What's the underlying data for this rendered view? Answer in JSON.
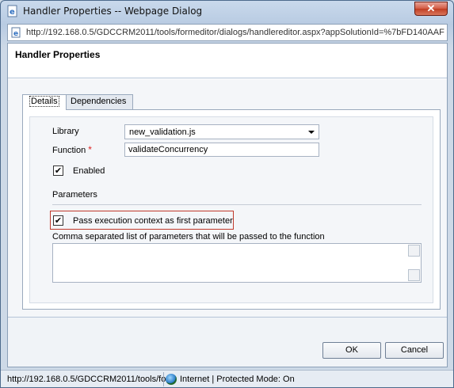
{
  "window": {
    "title": "Handler Properties -- Webpage Dialog",
    "close_label": "✕"
  },
  "address": {
    "url": "http://192.168.0.5/GDCCRM2011/tools/formeditor/dialogs/handlereditor.aspx?appSolutionId=%7bFD140AAF-4D"
  },
  "header": {
    "title": "Handler Properties"
  },
  "tabs": [
    {
      "label": "Details",
      "active": true
    },
    {
      "label": "Dependencies",
      "active": false
    }
  ],
  "form": {
    "library_label": "Library",
    "library_value": "new_validation.js",
    "function_label": "Function",
    "required_mark": "*",
    "function_value": "validateConcurrency",
    "enabled_label": "Enabled",
    "enabled_checked": true,
    "parameters_heading": "Parameters",
    "pass_context_label": "Pass execution context as first parameter",
    "pass_context_checked": true,
    "params_list_label": "Comma separated list of parameters that will be passed to the function",
    "params_value": ""
  },
  "footer": {
    "ok_label": "OK",
    "cancel_label": "Cancel"
  },
  "status": {
    "url": "http://192.168.0.5/GDCCRM2011/tools/fo",
    "zone": "Internet | Protected Mode: On"
  },
  "check_glyph": "✔",
  "colors": {
    "highlight_border": "#c0392b",
    "close_button": "#c03d22",
    "required": "#dd2222"
  }
}
